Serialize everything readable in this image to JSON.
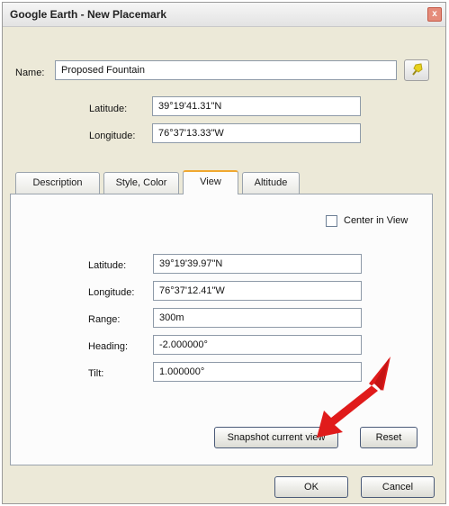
{
  "window": {
    "title": "Google Earth - New Placemark",
    "close_glyph": "x"
  },
  "placemark": {
    "name_label": "Name:",
    "name_value": "Proposed Fountain",
    "latitude_label": "Latitude:",
    "latitude_value": "39°19'41.31\"N",
    "longitude_label": "Longitude:",
    "longitude_value": "76°37'13.33\"W"
  },
  "tabs": [
    {
      "label": "Description",
      "active": false
    },
    {
      "label": "Style, Color",
      "active": false
    },
    {
      "label": "View",
      "active": true
    },
    {
      "label": "Altitude",
      "active": false
    }
  ],
  "view": {
    "center_in_view_label": "Center in View",
    "center_in_view_checked": false,
    "fields": [
      {
        "label": "Latitude:",
        "value": "39°19'39.97\"N"
      },
      {
        "label": "Longitude:",
        "value": "76°37'12.41\"W"
      },
      {
        "label": "Range:",
        "value": "300m"
      },
      {
        "label": "Heading:",
        "value": "-2.000000°"
      },
      {
        "label": "Tilt:",
        "value": "1.000000°"
      }
    ],
    "snapshot_label": "Snapshot current view",
    "reset_label": "Reset"
  },
  "footer": {
    "ok_label": "OK",
    "cancel_label": "Cancel"
  },
  "colors": {
    "arrow": "#e01b1b",
    "active_tab_accent": "#f0a830",
    "pin_icon": "#e8d21e"
  },
  "icons": {
    "pin": "pushpin-icon",
    "close": "close-icon"
  }
}
